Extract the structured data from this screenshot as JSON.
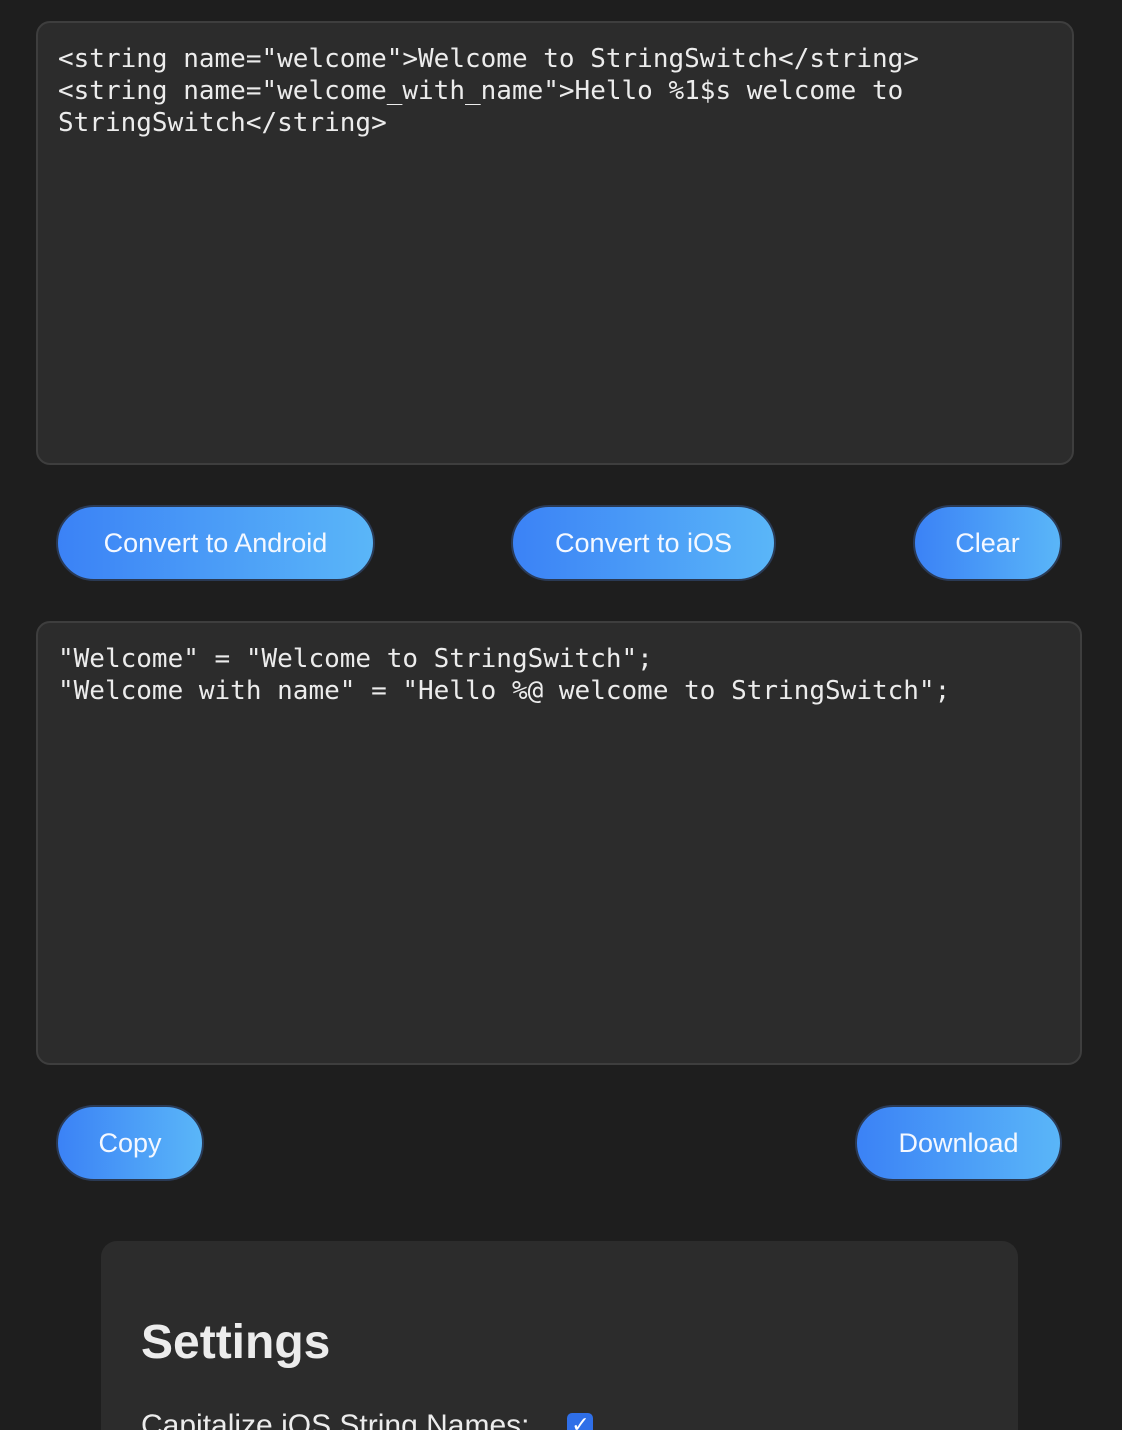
{
  "input": {
    "text": "<string name=\"welcome\">Welcome to StringSwitch</string>\n<string name=\"welcome_with_name\">Hello %1$s welcome to\nStringSwitch</string>"
  },
  "actions": {
    "convert_android_label": "Convert to Android",
    "convert_ios_label": "Convert to iOS",
    "clear_label": "Clear"
  },
  "output": {
    "text": "\"Welcome\" = \"Welcome to StringSwitch\";\n\"Welcome with name\" = \"Hello %@ welcome to StringSwitch\";"
  },
  "output_actions": {
    "copy_label": "Copy",
    "download_label": "Download"
  },
  "settings": {
    "title": "Settings",
    "capitalize_label": "Capitalize iOS String Names:",
    "capitalize_checked": true,
    "checkmark_icon": "check-icon"
  },
  "colors": {
    "background": "#1e1e1e",
    "panel": "#2c2c2c",
    "button_gradient_start": "#3b82f6",
    "button_gradient_end": "#5ab6f8",
    "checkbox": "#2f6fe8"
  }
}
